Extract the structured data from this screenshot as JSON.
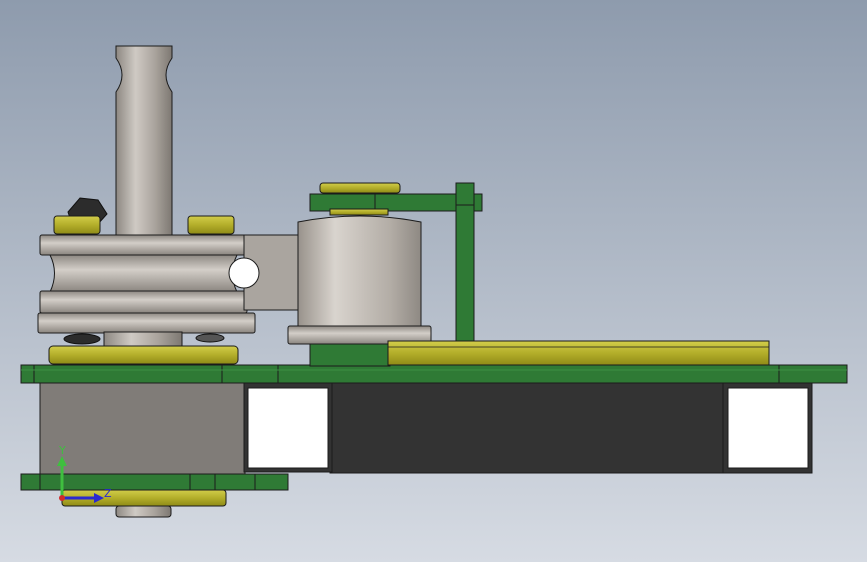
{
  "viewport": {
    "background_top": "#8e9bad",
    "background_bottom": "#d6dbe3"
  },
  "colors": {
    "green_face": "#2f7a35",
    "green_dark": "#1e5a24",
    "green_light": "#3d9044",
    "yellow_face": "#a6a21c",
    "yellow_light": "#c9c43a",
    "steel_light": "#c9c4be",
    "steel_mid": "#a8a29b",
    "steel_dark": "#7f7a74",
    "frame_gray": "#807c78",
    "frame_dark": "#333333",
    "edge": "#1b1b1b",
    "axis_y": "#3fbf3f",
    "axis_z": "#2a2ad0",
    "axis_x": "#d02a2a"
  },
  "triad": {
    "y_label": "Y",
    "z_label": "Z"
  }
}
